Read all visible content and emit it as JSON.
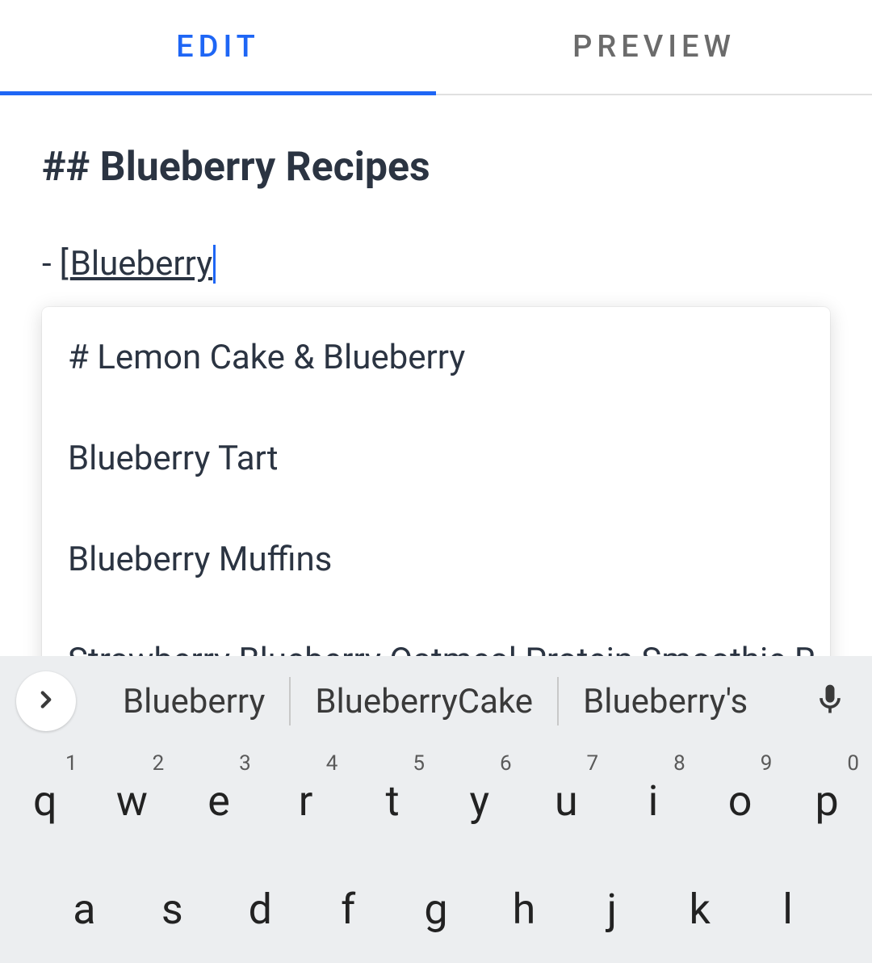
{
  "tabs": {
    "edit": "EDIT",
    "preview": "PREVIEW"
  },
  "editor": {
    "heading": "## Blueberry Recipes",
    "list_prefix_dash": "-",
    "list_prefix_bracket": "[",
    "link_typed": "Blueberry"
  },
  "suggestions": [
    "# Lemon Cake & Blueberry",
    "Blueberry Tart",
    "Blueberry Muffins",
    "Strawberry Blueberry Oatmeal Protein Smoothie R"
  ],
  "keyboard": {
    "word_suggestions": [
      "Blueberry",
      "BlueberryCake",
      "Blueberry's"
    ],
    "row1": [
      {
        "letter": "q",
        "num": "1"
      },
      {
        "letter": "w",
        "num": "2"
      },
      {
        "letter": "e",
        "num": "3"
      },
      {
        "letter": "r",
        "num": "4"
      },
      {
        "letter": "t",
        "num": "5"
      },
      {
        "letter": "y",
        "num": "6"
      },
      {
        "letter": "u",
        "num": "7"
      },
      {
        "letter": "i",
        "num": "8"
      },
      {
        "letter": "o",
        "num": "9"
      },
      {
        "letter": "p",
        "num": "0"
      }
    ],
    "row2": [
      {
        "letter": "a"
      },
      {
        "letter": "s"
      },
      {
        "letter": "d"
      },
      {
        "letter": "f"
      },
      {
        "letter": "g"
      },
      {
        "letter": "h"
      },
      {
        "letter": "j"
      },
      {
        "letter": "k"
      },
      {
        "letter": "l"
      }
    ]
  }
}
